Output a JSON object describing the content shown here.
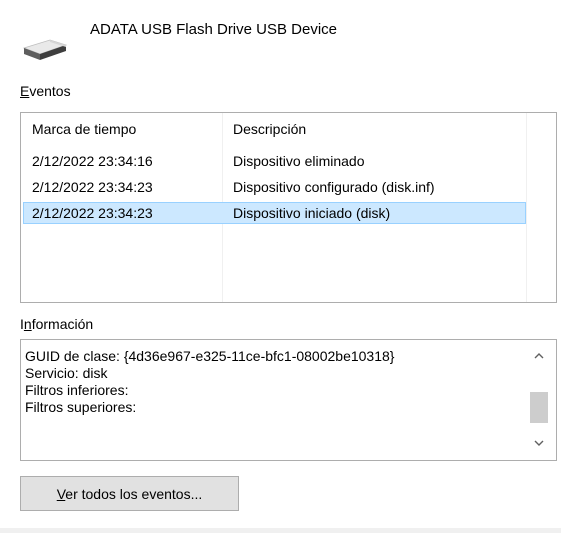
{
  "device": {
    "name": "ADATA USB Flash Drive USB Device",
    "icon": "usb-drive-icon"
  },
  "events": {
    "label": "Eventos",
    "columns": [
      "Marca de tiempo",
      "Descripción"
    ],
    "rows": [
      {
        "time": "2/12/2022 23:34:16",
        "description": "Dispositivo eliminado",
        "selected": false
      },
      {
        "time": "2/12/2022 23:34:23",
        "description": "Dispositivo configurado (disk.inf)",
        "selected": false
      },
      {
        "time": "2/12/2022 23:34:23",
        "description": "Dispositivo iniciado (disk)",
        "selected": true
      }
    ]
  },
  "info": {
    "label": "Información",
    "lines": [
      "GUID de clase: {4d36e967-e325-11ce-bfc1-08002be10318}",
      "Servicio: disk",
      "Filtros inferiores:",
      "Filtros superiores:"
    ],
    "scroll_position": 0.8
  },
  "buttons": {
    "view_all_label": "Ver todos los eventos..."
  },
  "colors": {
    "selection_fill": "#cce8ff",
    "selection_border": "#99d1ff",
    "button_face": "#e1e1e1",
    "border": "#adadad",
    "scroll_thumb": "#cdcdcd"
  }
}
